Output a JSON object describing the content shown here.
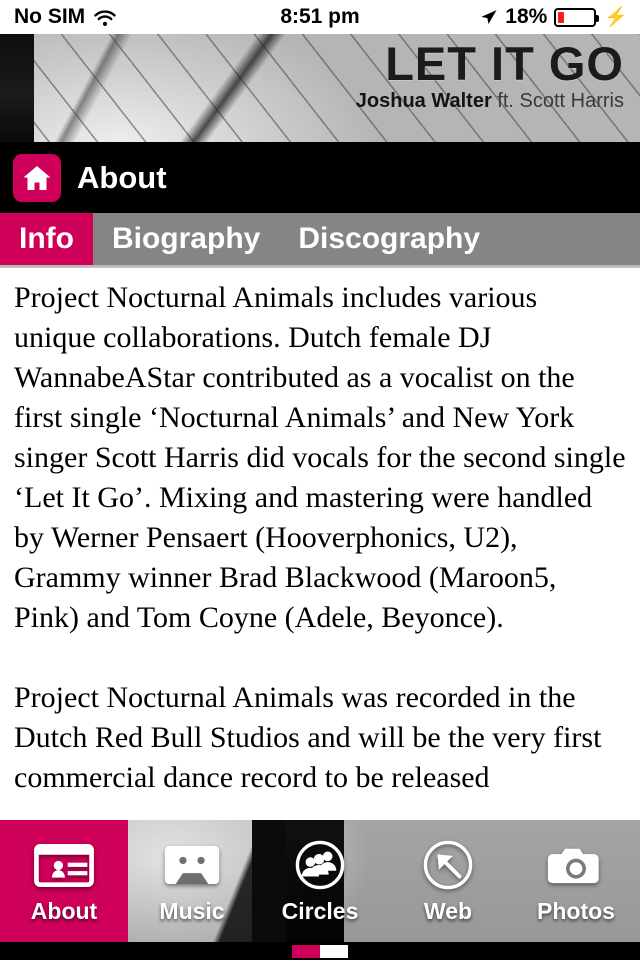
{
  "status_bar": {
    "carrier": "No SIM",
    "wifi_icon": "wifi-icon",
    "time": "8:51 pm",
    "location_icon": "location-arrow-icon",
    "battery_percent": "18%",
    "battery_level": 18,
    "battery_icon": "battery-icon",
    "charging_icon": "lightning-bolt-icon"
  },
  "banner": {
    "title": "LET IT GO",
    "artist": "Joshua Walter",
    "featuring": " ft. Scott Harris",
    "image_description": "grayscale-striped-shirt-photo"
  },
  "navbar": {
    "home_icon": "home-icon",
    "title": "About"
  },
  "segmented_tabs": {
    "active": "Info",
    "items": [
      {
        "label": "Info",
        "active": true
      },
      {
        "label": "Biography",
        "active": false
      },
      {
        "label": "Discography",
        "active": false
      }
    ]
  },
  "content": {
    "paragraphs": [
      "Project Nocturnal Animals includes various unique collaborations. Dutch female DJ WannabeAStar contributed as a vocalist on the first single ‘Nocturnal Animals’ and New York singer Scott Harris did vocals for the second single ‘Let It Go’. Mixing and mastering were handled by Werner Pensaert (Hooverphonics, U2), Grammy winner Brad Blackwood (Maroon5, Pink) and Tom Coyne (Adele, Beyonce).",
      "Project Nocturnal Animals was recorded in the Dutch Red Bull Studios and will be the very first commercial dance record to be released"
    ]
  },
  "bottom_bar": {
    "items": [
      {
        "label": "About",
        "icon": "id-card-icon",
        "active": true
      },
      {
        "label": "Music",
        "icon": "cassette-tape-icon",
        "active": false
      },
      {
        "label": "Circles",
        "icon": "people-circle-icon",
        "active": false
      },
      {
        "label": "Web",
        "icon": "arrow-circle-icon",
        "active": false
      },
      {
        "label": "Photos",
        "icon": "camera-icon",
        "active": false
      }
    ],
    "page_indicator": {
      "pages": 2,
      "current": 1
    }
  },
  "colors": {
    "accent_pink": "#CE0059",
    "navbar_black": "#000000",
    "tabbar_gray": "#858585",
    "battery_red": "#FF1A1A",
    "text_black": "#000000"
  }
}
